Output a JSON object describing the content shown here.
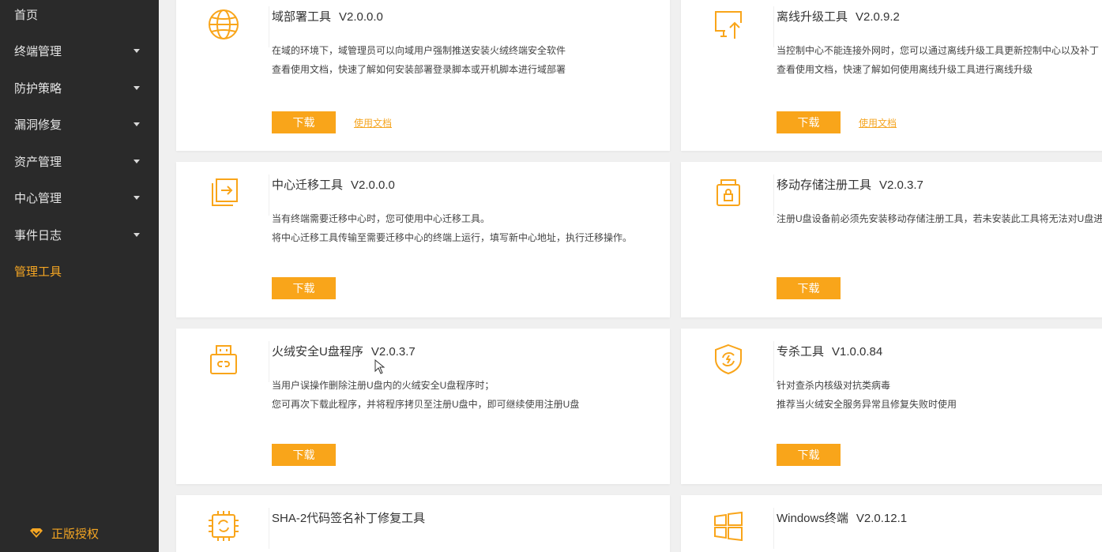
{
  "sidebar": {
    "items": [
      {
        "label": "首页",
        "has_arrow": false,
        "active": false
      },
      {
        "label": "终端管理",
        "has_arrow": true,
        "active": false
      },
      {
        "label": "防护策略",
        "has_arrow": true,
        "active": false
      },
      {
        "label": "漏洞修复",
        "has_arrow": true,
        "active": false
      },
      {
        "label": "资产管理",
        "has_arrow": true,
        "active": false
      },
      {
        "label": "中心管理",
        "has_arrow": true,
        "active": false
      },
      {
        "label": "事件日志",
        "has_arrow": true,
        "active": false
      },
      {
        "label": "管理工具",
        "has_arrow": false,
        "active": true
      }
    ],
    "license_label": "正版授权"
  },
  "colors": {
    "accent": "#f9a51a",
    "sidebar_bg": "#2a2a2a",
    "active_text": "#f5a623"
  },
  "tools": [
    {
      "icon": "globe-icon",
      "name": "域部署工具",
      "version": "V2.0.0.0",
      "desc": [
        "在域的环境下，域管理员可以向域用户强制推送安装火绒终端安全软件",
        "查看使用文档，快速了解如何安装部署登录脚本或开机脚本进行域部署"
      ],
      "download_label": "下载",
      "doc_label": "使用文档"
    },
    {
      "icon": "monitor-upload-icon",
      "name": "离线升级工具",
      "version": "V2.0.9.2",
      "desc": [
        "当控制中心不能连接外网时，您可以通过离线升级工具更新控制中心以及补丁",
        "查看使用文档，快速了解如何使用离线升级工具进行离线升级"
      ],
      "download_label": "下载",
      "doc_label": "使用文档"
    },
    {
      "icon": "migrate-icon",
      "name": "中心迁移工具",
      "version": "V2.0.0.0",
      "desc": [
        "当有终端需要迁移中心时，您可使用中心迁移工具。",
        "将中心迁移工具传输至需要迁移中心的终端上运行，填写新中心地址，执行迁移操作。"
      ],
      "download_label": "下载"
    },
    {
      "icon": "storage-lock-icon",
      "name": "移动存储注册工具",
      "version": "V2.0.3.7",
      "desc": [
        "注册U盘设备前必须先安装移动存储注册工具，若未安装此工具将无法对U盘进"
      ],
      "download_label": "下载"
    },
    {
      "icon": "usb-drive-icon",
      "name": "火绒安全U盘程序",
      "version": "V2.0.3.7",
      "desc": [
        "当用户误操作删除注册U盘内的火绒安全U盘程序时；",
        "您可再次下载此程序，并将程序拷贝至注册U盘中，即可继续使用注册U盘"
      ],
      "download_label": "下载"
    },
    {
      "icon": "shield-bolt-icon",
      "name": "专杀工具",
      "version": "V1.0.0.84",
      "desc": [
        "针对查杀内核级对抗类病毒",
        "推荐当火绒安全服务异常且修复失败时使用"
      ],
      "download_label": "下载"
    },
    {
      "icon": "chip-refresh-icon",
      "name": "SHA-2代码签名补丁修复工具",
      "version": "",
      "desc": []
    },
    {
      "icon": "windows-icon",
      "name": "Windows终端",
      "version": "V2.0.12.1",
      "desc": []
    }
  ]
}
